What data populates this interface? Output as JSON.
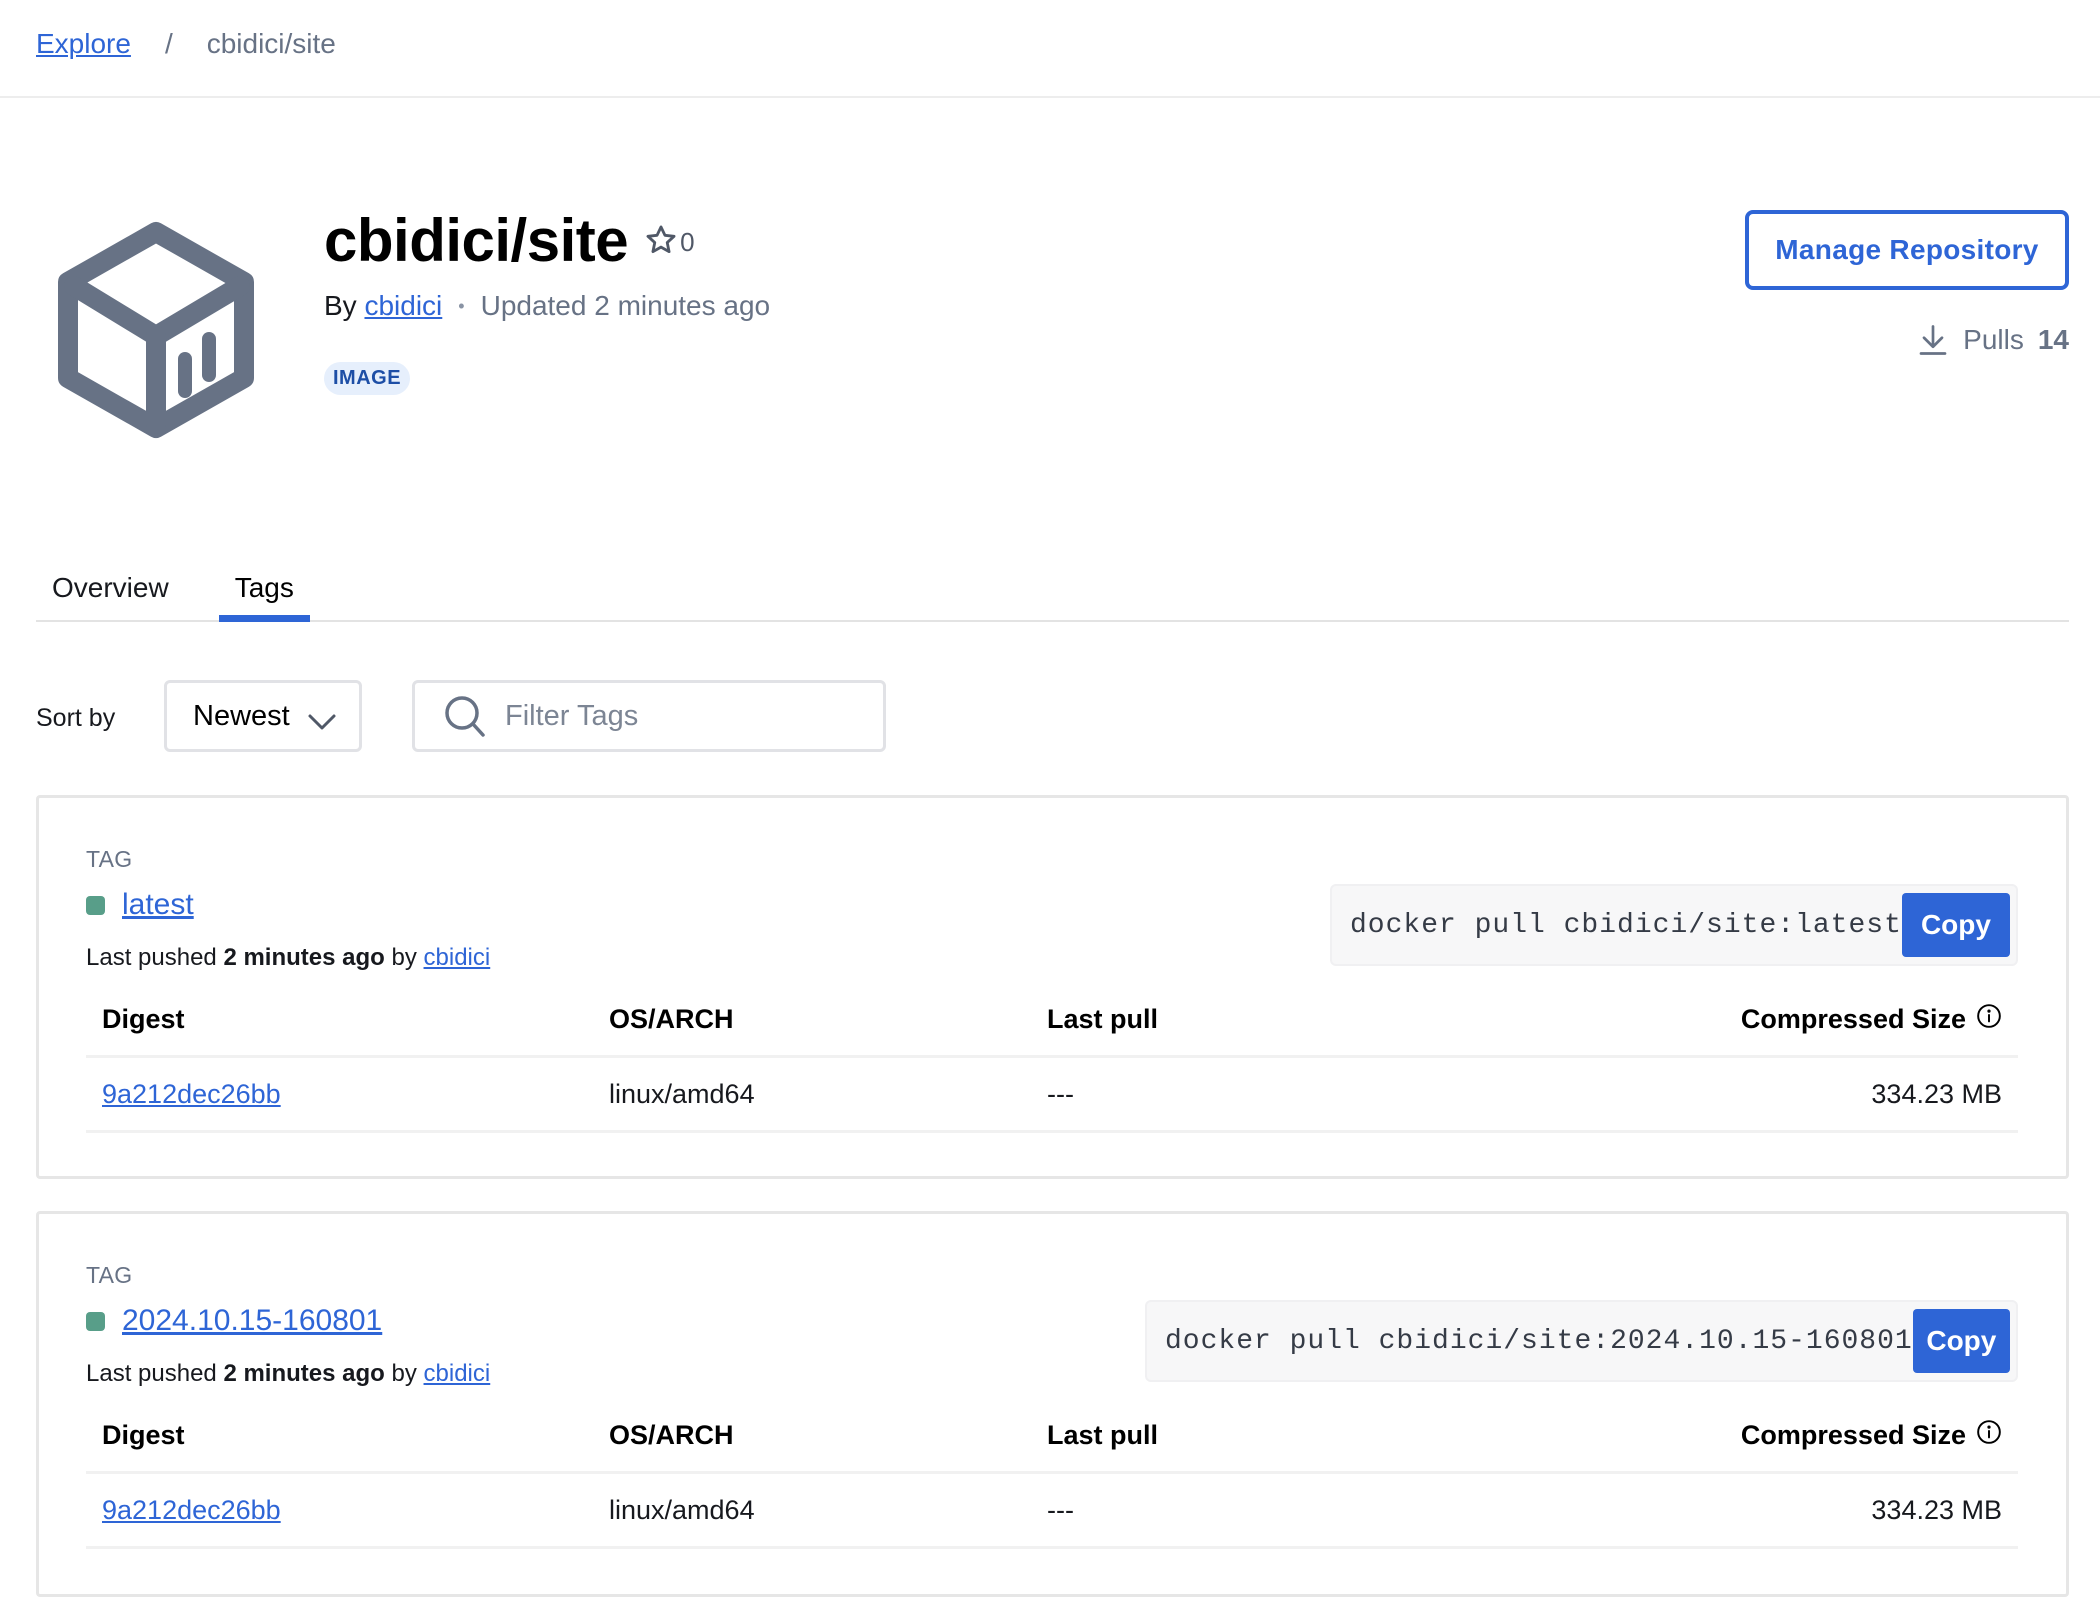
{
  "breadcrumb": {
    "explore": "Explore",
    "separator": "/",
    "current": "cbidici/site"
  },
  "repo": {
    "title": "cbidici/site",
    "stars": "0",
    "by_label": "By",
    "owner": "cbidici",
    "dot": "•",
    "updated": "Updated 2 minutes ago",
    "badge": "IMAGE",
    "manage_button": "Manage Repository",
    "pulls_label": "Pulls",
    "pulls_count": "14"
  },
  "tabs": [
    {
      "label": "Overview",
      "active": false
    },
    {
      "label": "Tags",
      "active": true
    }
  ],
  "controls": {
    "sort_label": "Sort by",
    "sort_value": "Newest",
    "filter_placeholder": "Filter Tags"
  },
  "table_headers": {
    "digest": "Digest",
    "os_arch": "OS/ARCH",
    "last_pull": "Last pull",
    "compressed_size": "Compressed Size"
  },
  "tags": [
    {
      "section_label": "TAG",
      "name": "latest",
      "pushed_prefix": "Last pushed",
      "pushed_time": "2 minutes ago",
      "pushed_by_label": "by",
      "pushed_by": "cbidici",
      "pull_command": "docker pull cbidici/site:latest",
      "copy_label": "Copy",
      "rows": [
        {
          "digest": "9a212dec26bb",
          "os_arch": "linux/amd64",
          "last_pull": "---",
          "size": "334.23 MB"
        }
      ]
    },
    {
      "section_label": "TAG",
      "name": "2024.10.15-160801",
      "pushed_prefix": "Last pushed",
      "pushed_time": "2 minutes ago",
      "pushed_by_label": "by",
      "pushed_by": "cbidici",
      "pull_command": "docker pull cbidici/site:2024.10.15-160801",
      "copy_label": "Copy",
      "rows": [
        {
          "digest": "9a212dec26bb",
          "os_arch": "linux/amd64",
          "last_pull": "---",
          "size": "334.23 MB"
        }
      ]
    }
  ],
  "colors": {
    "accent": "#2e65d6",
    "tag_status": "#589e89",
    "icon_gray": "#677285",
    "badge_bg": "#e6effc"
  }
}
